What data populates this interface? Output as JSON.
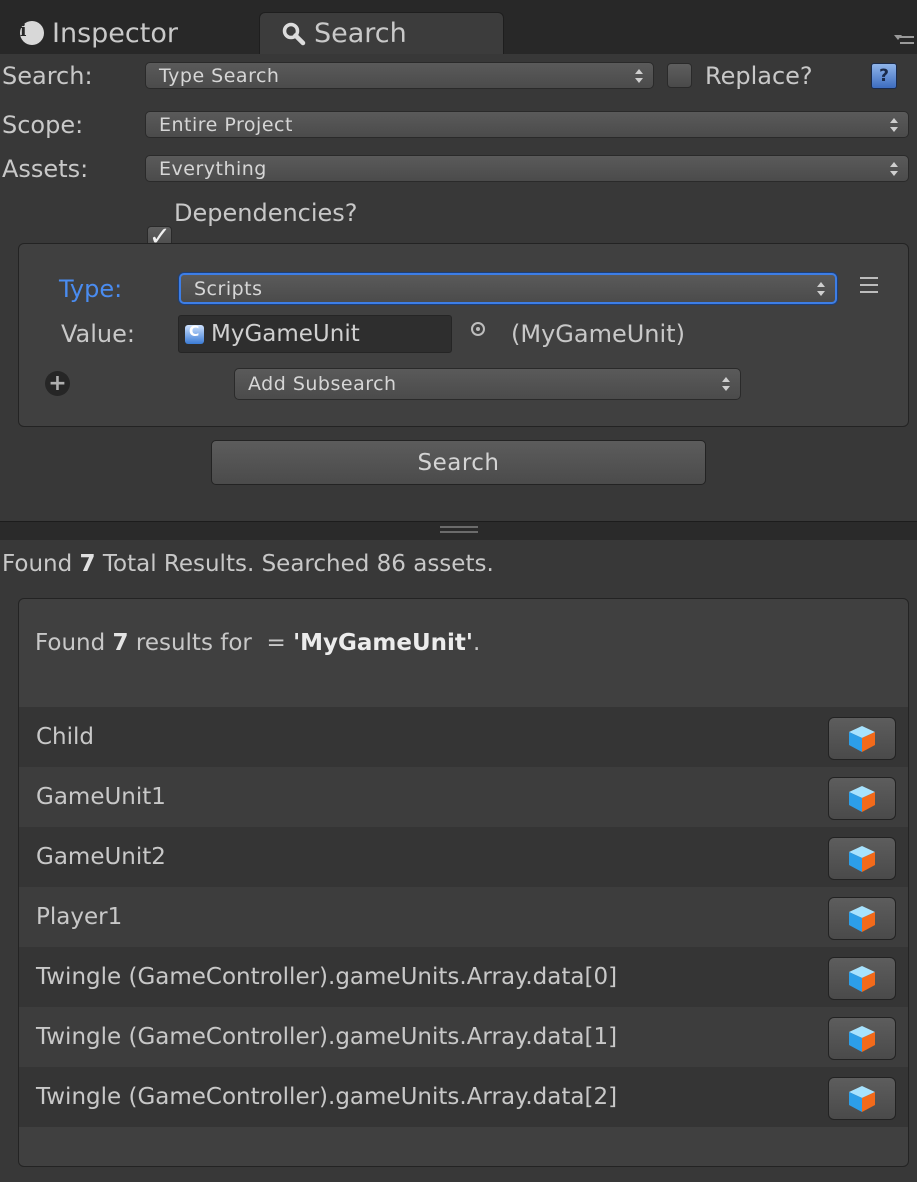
{
  "tabs": [
    {
      "label": "Inspector",
      "icon": "info-icon",
      "active": false
    },
    {
      "label": "Search",
      "icon": "magnifier-icon",
      "active": true
    }
  ],
  "form": {
    "search_label": "Search:",
    "search_value": "Type Search",
    "replace_label": "Replace?",
    "replace_checked": false,
    "scope_label": "Scope:",
    "scope_value": "Entire Project",
    "assets_label": "Assets:",
    "assets_value": "Everything",
    "dependencies_label": "Dependencies?",
    "dependencies_checked": true
  },
  "query": {
    "type_label": "Type:",
    "type_value": "Scripts",
    "value_label": "Value:",
    "value_field": "MyGameUnit",
    "value_resolved": "(MyGameUnit)",
    "add_subsearch": "Add Subsearch",
    "search_button": "Search"
  },
  "summary": {
    "prefix": "Found ",
    "count": "7",
    "middle": " Total Results. Searched 86 assets."
  },
  "results_header": {
    "prefix": "Found ",
    "count": "7",
    "middle": " results for  = ",
    "term": "'MyGameUnit'",
    "suffix": "."
  },
  "results": [
    {
      "name": "Child",
      "icon": "prefab-cube-icon"
    },
    {
      "name": "GameUnit1",
      "icon": "prefab-cube-icon"
    },
    {
      "name": "GameUnit2",
      "icon": "prefab-cube-icon"
    },
    {
      "name": "Player1",
      "icon": "prefab-cube-icon"
    },
    {
      "name": "Twingle (GameController).gameUnits.Array.data[0]",
      "icon": "prefab-cube-icon"
    },
    {
      "name": "Twingle (GameController).gameUnits.Array.data[1]",
      "icon": "prefab-cube-icon"
    },
    {
      "name": "Twingle (GameController).gameUnits.Array.data[2]",
      "icon": "prefab-cube-icon"
    }
  ],
  "colors": {
    "panel": "#383838",
    "tabbar": "#282828",
    "accent_blue": "#3d7ee6",
    "type_label": "#4a8cf0"
  }
}
